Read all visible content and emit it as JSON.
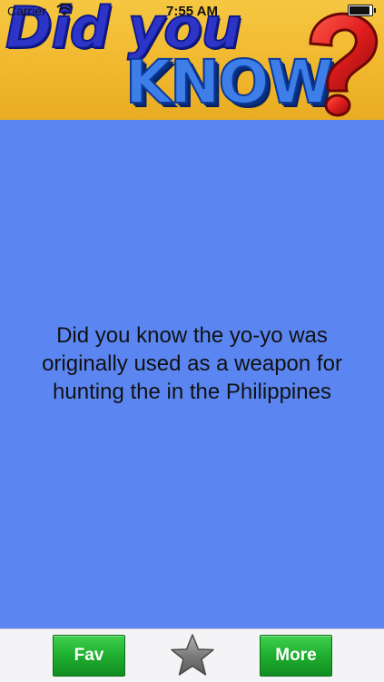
{
  "status_bar": {
    "carrier": "Carrier",
    "time": "7:55 AM",
    "wifi_icon": "wifi-icon",
    "battery_icon": "battery-icon"
  },
  "header": {
    "logo_line1": "Did you",
    "logo_line2": "KNOW",
    "logo_icon": "question-mark-icon"
  },
  "main": {
    "fact_text": "Did you know the yo-yo was originally used as a weapon for hunting the in the Philippines"
  },
  "toolbar": {
    "fav_label": "Fav",
    "star_icon": "star-icon",
    "more_label": "More"
  },
  "colors": {
    "background": "#5b86f2",
    "banner": "#f0b62c",
    "button_green": "#1fae2f",
    "toolbar": "#f4f4f6"
  }
}
